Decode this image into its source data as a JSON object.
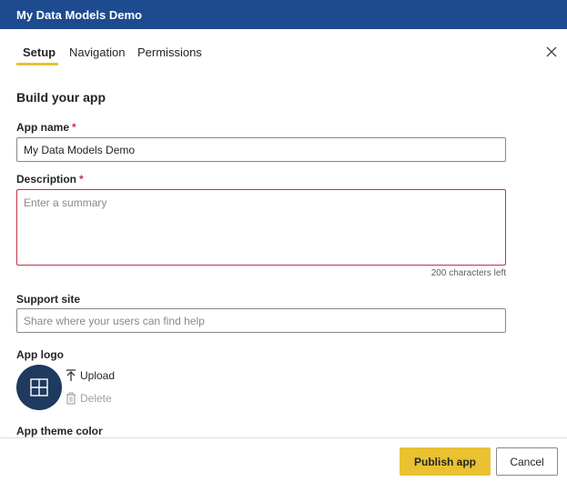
{
  "window": {
    "title": "My Data Models Demo"
  },
  "tabs": [
    {
      "label": "Setup",
      "active": true
    },
    {
      "label": "Navigation",
      "active": false
    },
    {
      "label": "Permissions",
      "active": false
    }
  ],
  "close_icon": "close-icon",
  "form": {
    "heading": "Build your app",
    "app_name": {
      "label": "App name",
      "required_mark": "*",
      "value": "My Data Models Demo"
    },
    "description": {
      "label": "Description",
      "required_mark": "*",
      "placeholder": "Enter a summary",
      "value": "",
      "chars_left": "200 characters left"
    },
    "support_site": {
      "label": "Support site",
      "placeholder": "Share where your users can find help",
      "value": ""
    },
    "app_logo": {
      "label": "App logo",
      "upload_label": "Upload",
      "delete_label": "Delete",
      "logo_icon": "layout-icon"
    },
    "theme_color": {
      "label": "App theme color"
    }
  },
  "footer": {
    "publish_label": "Publish app",
    "cancel_label": "Cancel"
  },
  "colors": {
    "header": "#1e4b8f",
    "accent": "#e9c232",
    "error": "#c4314b",
    "logo_bg": "#1e3a5f"
  }
}
